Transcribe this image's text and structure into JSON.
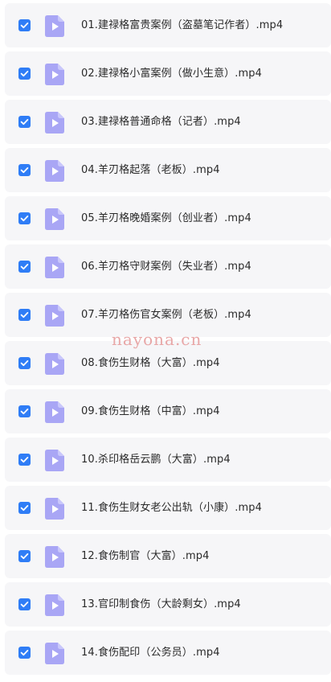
{
  "files": [
    {
      "name": "01.建禄格富贵案例（盗墓笔记作者）.mp4",
      "checked": true
    },
    {
      "name": "02.建禄格小富案例（做小生意）.mp4",
      "checked": true
    },
    {
      "name": "03.建禄格普通命格（记者）.mp4",
      "checked": true
    },
    {
      "name": "04.羊刃格起落（老板）.mp4",
      "checked": true
    },
    {
      "name": "05.羊刃格晚婚案例（创业者）.mp4",
      "checked": true
    },
    {
      "name": "06.羊刃格守财案例（失业者）.mp4",
      "checked": true
    },
    {
      "name": "07.羊刃格伤官女案例（老板）.mp4",
      "checked": true
    },
    {
      "name": "08.食伤生财格（大富）.mp4",
      "checked": true
    },
    {
      "name": "09.食伤生财格（中富）.mp4",
      "checked": true
    },
    {
      "name": "10.杀印格岳云鹏（大富）.mp4",
      "checked": true
    },
    {
      "name": "11.食伤生财女老公出轨（小康）.mp4",
      "checked": true
    },
    {
      "name": "12.食伤制官（大富）.mp4",
      "checked": true
    },
    {
      "name": "13.官印制食伤（大龄剩女）.mp4",
      "checked": true
    },
    {
      "name": "14.食伤配印（公务员）.mp4",
      "checked": true
    }
  ],
  "watermark": "nayona.cn",
  "colors": {
    "checkbox": "#2f7df6",
    "video_icon": "#a9a6f5",
    "row_bg": "#f6f6f8"
  },
  "icons": {
    "checkbox": "checkmark-icon",
    "file": "video-file-icon"
  }
}
